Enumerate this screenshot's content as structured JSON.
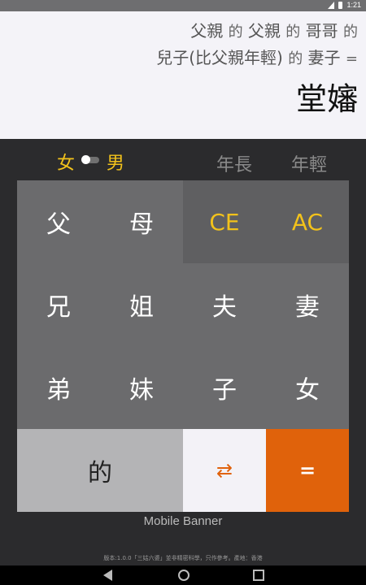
{
  "status": {
    "time": "1:21"
  },
  "display": {
    "line1": [
      "父親",
      "的",
      "父親",
      "的",
      "哥哥",
      "的"
    ],
    "line2": [
      "兒子(比父親年輕)",
      "的",
      "妻子",
      "="
    ],
    "result": "堂嬸"
  },
  "controls": {
    "female": "女",
    "male": "男",
    "older": "年長",
    "younger": "年輕"
  },
  "keys": [
    "父",
    "母",
    "CE",
    "AC",
    "兄",
    "姐",
    "夫",
    "妻",
    "弟",
    "妹",
    "子",
    "女",
    "的",
    "⇄",
    "="
  ],
  "banner": "Mobile Banner",
  "footer": "版本:1.0.0「三姑六婆」並非精密科學，只作參考。產地：香港"
}
